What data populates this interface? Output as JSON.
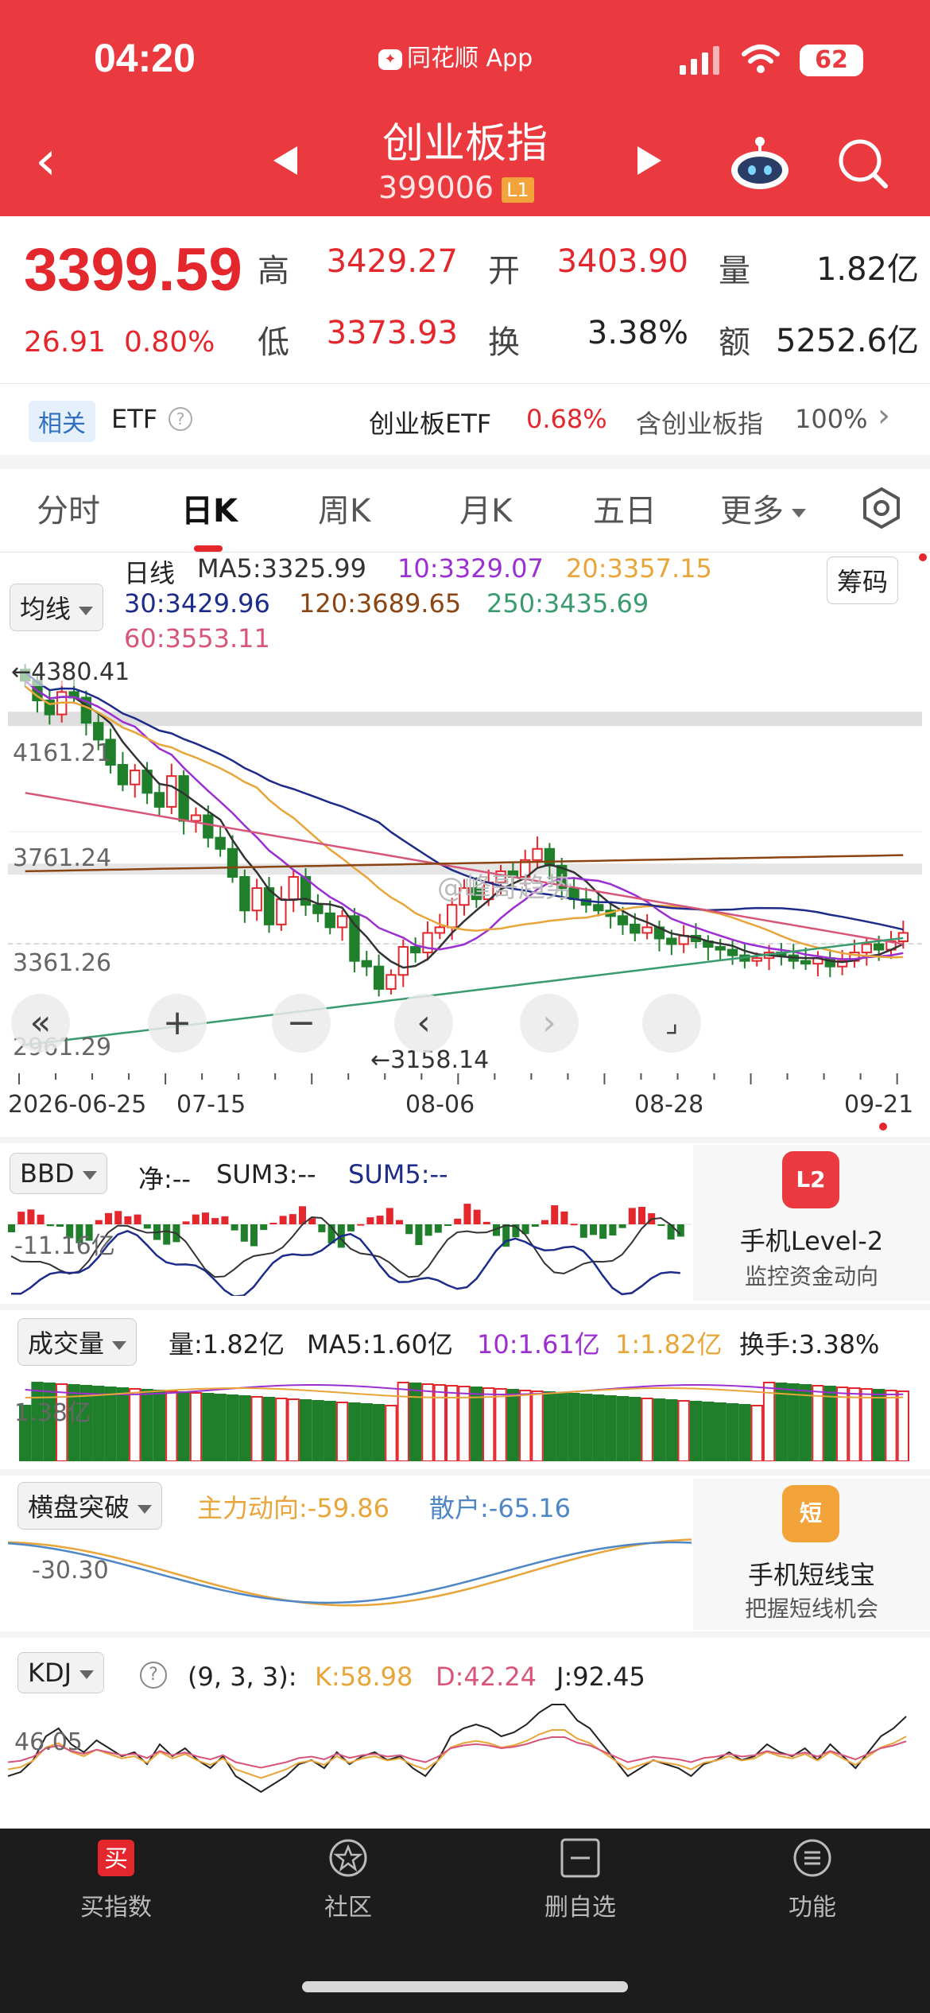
{
  "status_bar": {
    "time": "04:20",
    "app_name": "同花顺 App",
    "battery": "62"
  },
  "header": {
    "title": "创业板指",
    "code": "399006",
    "level_badge": "L1"
  },
  "quote": {
    "price": "3399.59",
    "change": "26.91",
    "change_pct": "0.80%",
    "high_label": "高",
    "high": "3429.27",
    "open_label": "开",
    "open": "3403.90",
    "volume_label": "量",
    "volume": "1.82亿",
    "low_label": "低",
    "low": "3373.93",
    "turnover_label": "换",
    "turnover": "3.38%",
    "amount_label": "额",
    "amount": "5252.6亿"
  },
  "etf_row": {
    "tag": "相关",
    "etf_label": "ETF",
    "etf_name": "创业板ETF",
    "etf_change": "0.68%",
    "contains_text": "含创业板指",
    "contains_pct": "100%"
  },
  "tabs": [
    "分时",
    "日K",
    "周K",
    "月K",
    "五日",
    "更多"
  ],
  "active_tab": "日K",
  "kline": {
    "indicator_select": "均线",
    "period_label": "日线",
    "chip_button": "筹码",
    "ma": [
      {
        "label": "MA5:3325.99",
        "color": "#333333"
      },
      {
        "label": "10:3329.07",
        "color": "#9b2fd1"
      },
      {
        "label": "20:3357.15",
        "color": "#e8a53a"
      },
      {
        "label": "30:3429.96",
        "color": "#1d2b8a"
      },
      {
        "label": "120:3689.65",
        "color": "#8b4513"
      },
      {
        "label": "250:3435.69",
        "color": "#3a9b6f"
      },
      {
        "label": "60:3553.11",
        "color": "#d8557a"
      }
    ],
    "y_labels": [
      "4380.41",
      "4161.21",
      "3761.24",
      "3361.26",
      "2961.29"
    ],
    "high_marker": "←4380.41",
    "low_marker": "←3158.14",
    "x_labels": [
      "2026-06-25",
      "07-15",
      "08-06",
      "08-28",
      "09-21"
    ],
    "watermark": "@峰哥趋势"
  },
  "bbd": {
    "select": "BBD",
    "net": "净:--",
    "sum3": "SUM3:--",
    "sum5": "SUM5:--",
    "y_label": "-11.16亿"
  },
  "promo_level2": {
    "icon": "L2",
    "title": "手机Level-2",
    "subtitle": "监控资金动向"
  },
  "volume_panel": {
    "select": "成交量",
    "vol": "量:1.82亿",
    "ma5": "MA5:1.60亿",
    "ma10": "10:1.61亿",
    "ma1": "1:1.82亿",
    "turnover": "换手:3.38%",
    "y_label": "1.38亿"
  },
  "breakout_panel": {
    "select": "横盘突破",
    "main": "主力动向:-59.86",
    "retail": "散户:-65.16",
    "y_label": "-30.30"
  },
  "promo_short": {
    "icon": "短",
    "title": "手机短线宝",
    "subtitle": "把握短线机会"
  },
  "kdj_panel": {
    "select": "KDJ",
    "params": "(9, 3, 3):",
    "k": "K:58.98",
    "d": "D:42.24",
    "j": "J:92.45",
    "y_label": "46.05"
  },
  "bottom_nav": [
    {
      "label": "买指数",
      "icon": "buy-icon"
    },
    {
      "label": "社区",
      "icon": "community-icon"
    },
    {
      "label": "删自选",
      "icon": "remove-watchlist-icon"
    },
    {
      "label": "功能",
      "icon": "menu-icon"
    }
  ],
  "colors": {
    "header_bg": "#ea3a3f",
    "up": "#e4262d",
    "down": "#1f7f2a",
    "nav_bg": "#1c1c1c"
  }
}
